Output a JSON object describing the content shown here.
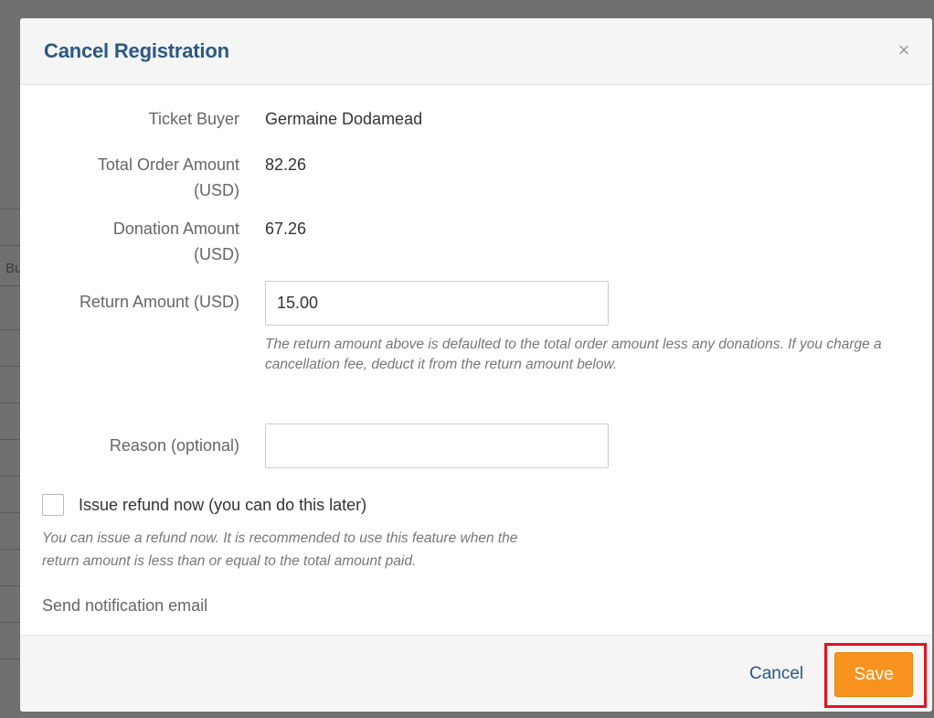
{
  "background": {
    "edge_text": "Bu"
  },
  "modal": {
    "title": "Cancel Registration",
    "close_symbol": "×",
    "fields": {
      "ticket_buyer": {
        "label": "Ticket Buyer",
        "value": "Germaine Dodamead"
      },
      "total_order": {
        "label_line1": "Total Order Amount",
        "label_line2": "(USD)",
        "value": "82.26"
      },
      "donation": {
        "label_line1": "Donation Amount",
        "label_line2": "(USD)",
        "value": "67.26"
      },
      "return_amount": {
        "label": "Return Amount (USD)",
        "value": "15.00",
        "help": "The return amount above is defaulted to the total order amount less any donations. If you charge a cancellation fee, deduct it from the return amount below."
      },
      "reason": {
        "label": "Reason (optional)",
        "value": ""
      }
    },
    "refund": {
      "checked": false,
      "label": "Issue refund now (you can do this later)",
      "help_line1": "You can issue a refund now. It is recommended to use this feature when the",
      "help_line2": "return amount is less than or equal to the total amount paid."
    },
    "notification_label": "Send notification email",
    "footer": {
      "cancel_label": "Cancel",
      "save_label": "Save"
    }
  },
  "colors": {
    "title": "#2a5885",
    "save_button": "#f7931e",
    "highlight_box": "#e0141e"
  }
}
